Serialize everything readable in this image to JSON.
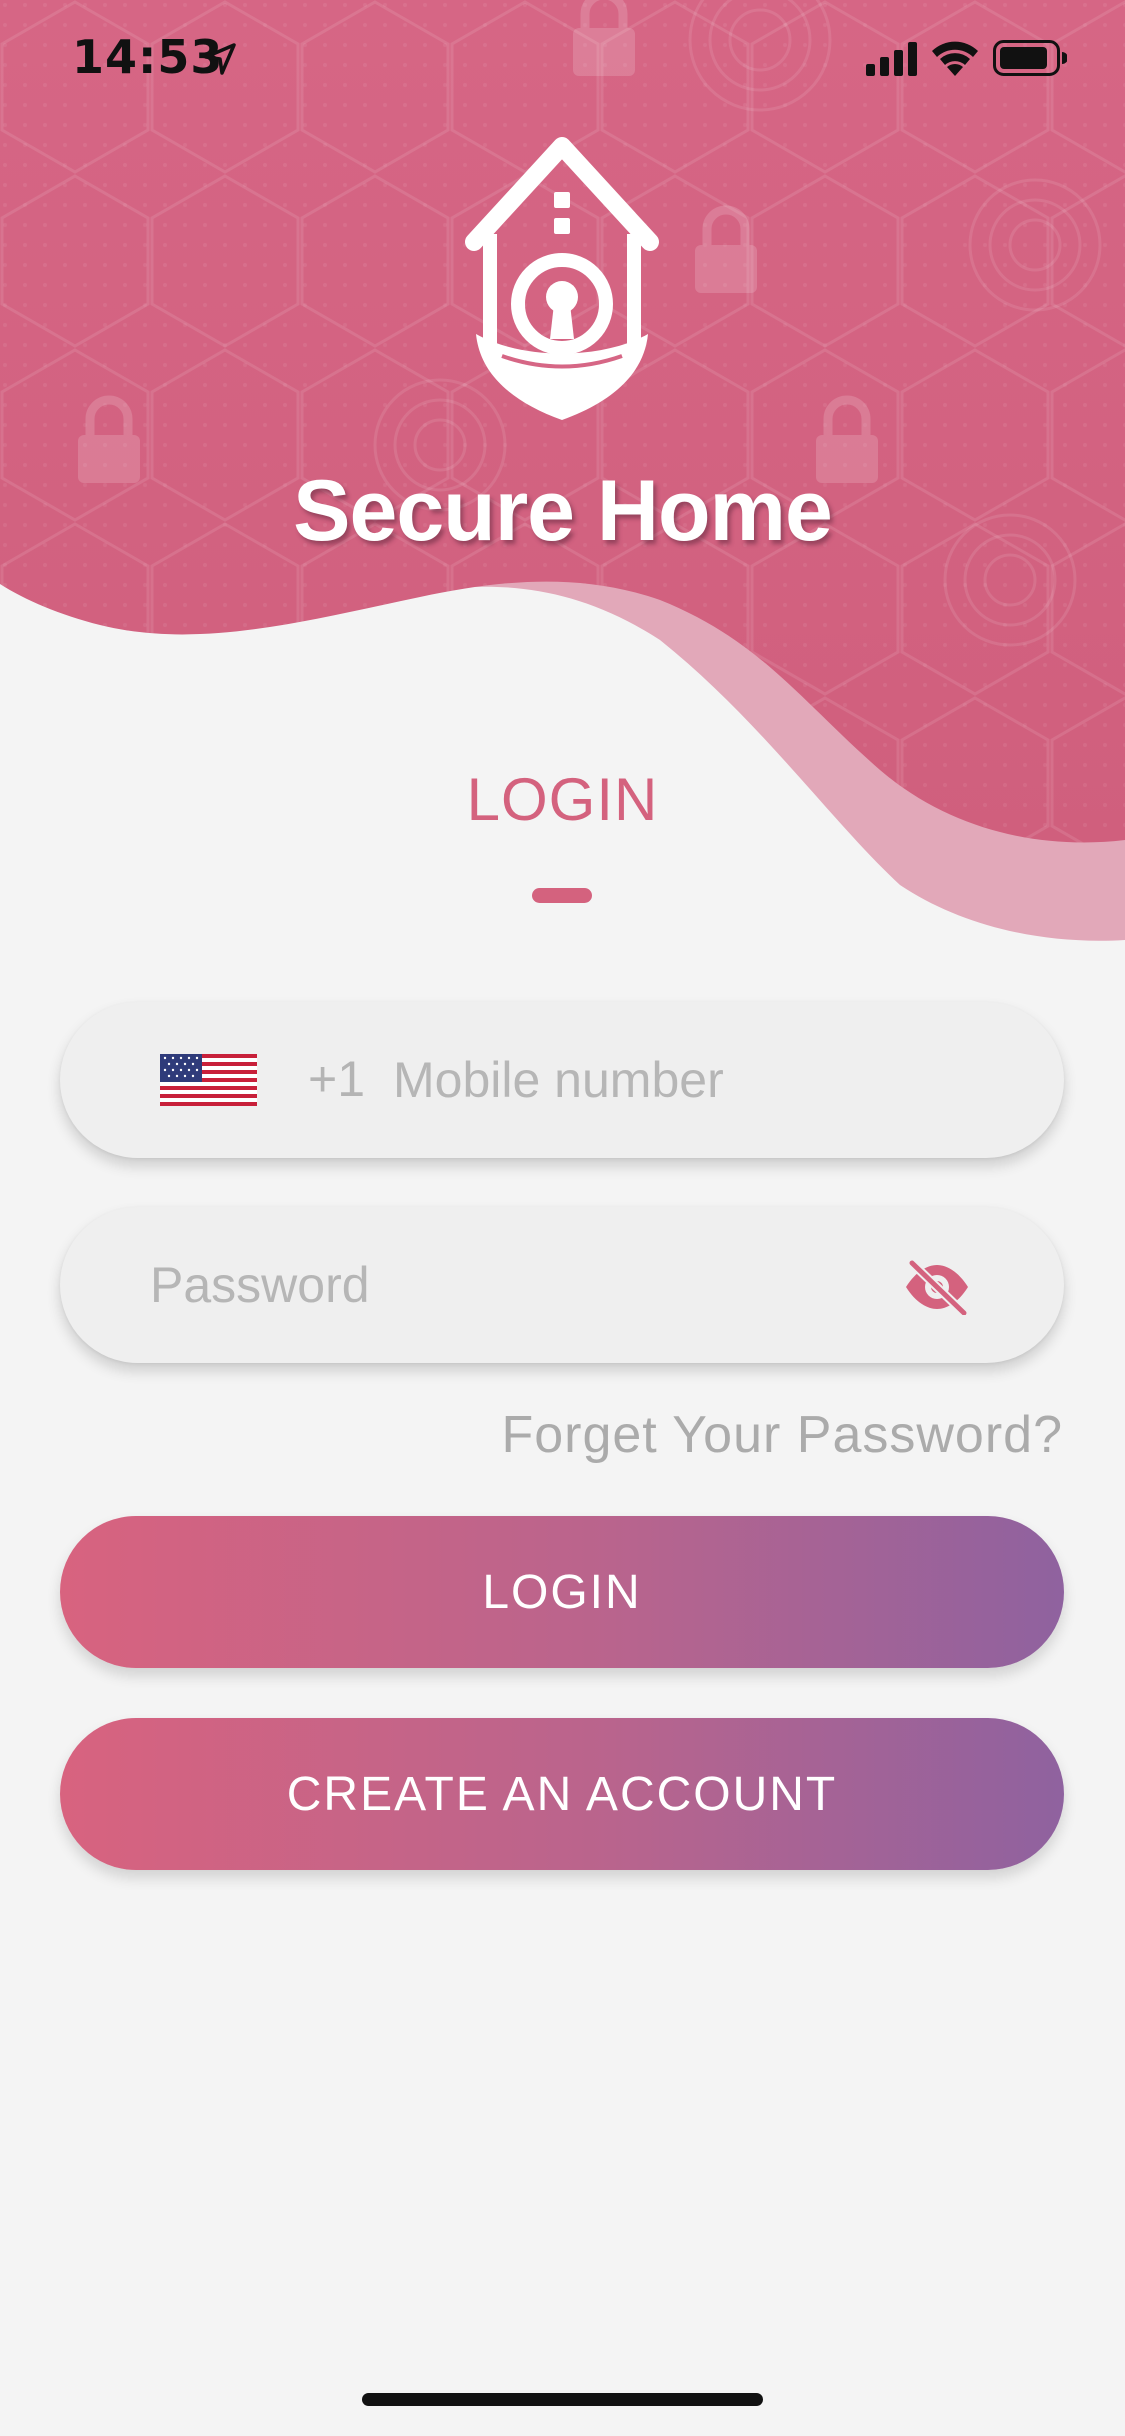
{
  "status_bar": {
    "time": "14:53",
    "icons": [
      "location-arrow-icon",
      "cellular-signal-icon",
      "wifi-icon",
      "battery-icon"
    ]
  },
  "header": {
    "app_title": "Secure Home",
    "logo_icon": "house-lock-shield-icon"
  },
  "login": {
    "heading": "LOGIN",
    "phone_field": {
      "flag_icon": "us-flag-icon",
      "country_code": "+1",
      "placeholder": "Mobile number"
    },
    "password_field": {
      "placeholder": "Password",
      "toggle_icon": "eye-off-icon"
    },
    "forgot_password": "Forget Your Password?",
    "login_button": "LOGIN",
    "create_account_button": "CREATE AN ACCOUNT"
  },
  "colors": {
    "header_pink": "#d4627e",
    "wave_light_pink": "#e2a8b9",
    "background": "#f4f4f4",
    "accent": "#d4627e",
    "button_gradient_start": "#d8637f",
    "button_gradient_end": "#8f629f",
    "field_background": "#efefef",
    "placeholder_gray": "#b6b6b6"
  }
}
